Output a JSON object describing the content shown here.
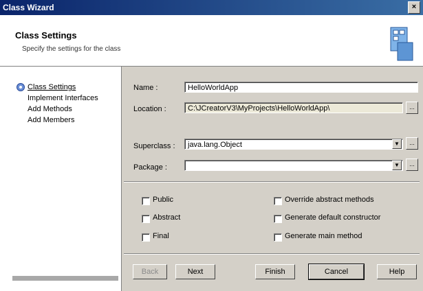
{
  "window": {
    "title": "Class Wizard",
    "close_glyph": "×"
  },
  "header": {
    "title": "Class Settings",
    "subtitle": "Specify the settings for the class",
    "icon": "wizard-form-icon"
  },
  "sidebar": {
    "items": [
      {
        "label": "Class Settings"
      },
      {
        "label": "Implement Interfaces"
      },
      {
        "label": "Add Methods"
      },
      {
        "label": "Add Members"
      }
    ]
  },
  "form": {
    "name_label": "Name :",
    "name_value": "HelloWorldApp",
    "location_label": "Location :",
    "location_value": "C:\\JCreatorV3\\MyProjects\\HelloWorldApp\\",
    "superclass_label": "Superclass :",
    "superclass_value": "java.lang.Object",
    "package_label": "Package :",
    "package_value": "",
    "browse_label": "..."
  },
  "options": {
    "public": "Public",
    "abstract": "Abstract",
    "final": "Final",
    "override": "Override abstract methods",
    "default_ctor": "Generate default constructor",
    "main_method": "Generate main method"
  },
  "buttons": {
    "back": "Back",
    "next": "Next",
    "finish": "Finish",
    "cancel": "Cancel",
    "help": "Help"
  }
}
